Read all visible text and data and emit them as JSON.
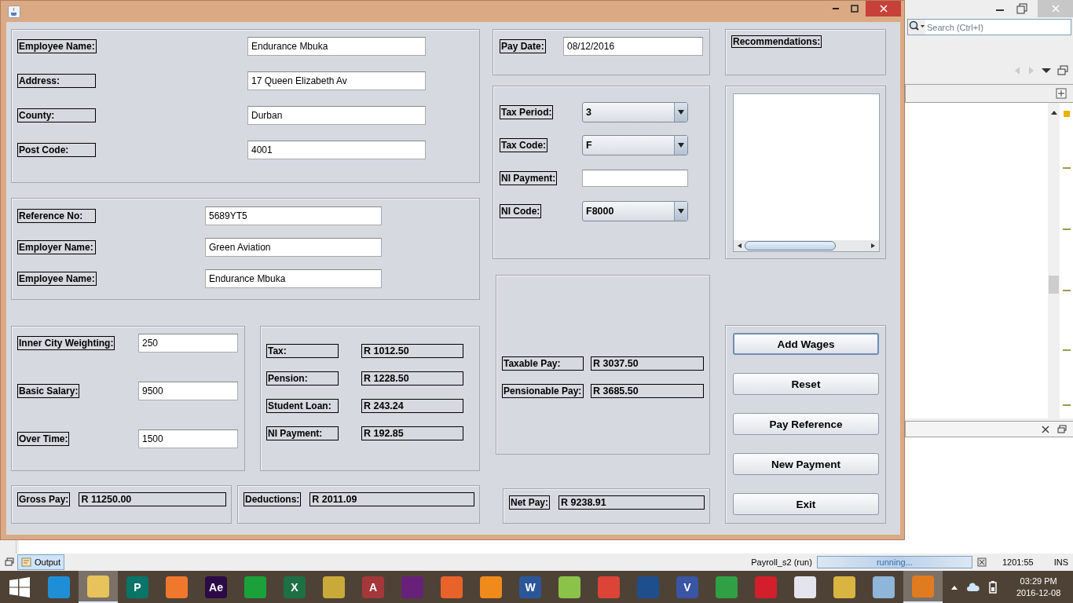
{
  "personal": [
    {
      "label": "Employee Name:",
      "value": "Endurance Mbuka"
    },
    {
      "label": "Address:",
      "value": "17 Queen Elizabeth Av"
    },
    {
      "label": "County:",
      "value": "Durban"
    },
    {
      "label": "Post Code:",
      "value": "4001"
    }
  ],
  "employment": [
    {
      "label": "Reference No:",
      "value": "5689YT5"
    },
    {
      "label": "Employer Name:",
      "value": "Green Aviation"
    },
    {
      "label": "Employee Name:",
      "value": "Endurance Mbuka"
    }
  ],
  "pay_date": {
    "label": "Pay Date:",
    "value": "08/12/2016"
  },
  "recommendations": {
    "label": "Recommendations:"
  },
  "tax_settings": [
    {
      "kind": "combo",
      "label": "Tax Period:",
      "value": "3"
    },
    {
      "kind": "combo",
      "label": "Tax Code:",
      "value": "F"
    },
    {
      "kind": "field",
      "label": "NI Payment:"
    },
    {
      "kind": "combo",
      "label": "NI Code:",
      "value": "F8000"
    }
  ],
  "earnings": [
    {
      "label": "Inner City Weighting:",
      "value": "250"
    },
    {
      "label": "Basic Salary:",
      "value": "9500"
    },
    {
      "label": "Over Time:",
      "value": "1500"
    }
  ],
  "deductions": [
    {
      "label": "Tax:",
      "value": "R 1012.50"
    },
    {
      "label": "Pension:",
      "value": "R 1228.50"
    },
    {
      "label": "Student Loan:",
      "value": "R 243.24"
    },
    {
      "label": "NI Payment:",
      "value": "R 192.85"
    }
  ],
  "taxable": [
    {
      "label": "Taxable Pay:",
      "value": "R 3037.50"
    },
    {
      "label": "Pensionable Pay:",
      "value": "R 3685.50"
    }
  ],
  "totals": {
    "gross": {
      "label": "Gross Pay:",
      "value": "R 11250.00"
    },
    "deductions": {
      "label": "Deductions:",
      "value": "R 2011.09"
    },
    "net": {
      "label": "Net Pay:",
      "value": "R 9238.91"
    }
  },
  "buttons": [
    {
      "label": "Add Wages",
      "focused": true
    },
    {
      "label": "Reset",
      "focused": false
    },
    {
      "label": "Pay Reference",
      "focused": false
    },
    {
      "label": "New Payment",
      "focused": false
    },
    {
      "label": "Exit",
      "focused": false
    }
  ],
  "ide": {
    "search_placeholder": "Search (Ctrl+I)",
    "output_tab": "Output",
    "process": "Payroll_s2 (run)",
    "progress": "running...",
    "busy": true,
    "position": "1201:55",
    "mode": "INS"
  },
  "taskbar": {
    "apps": [
      {
        "color": "#1e8fd6",
        "highlighted": false
      },
      {
        "color": "#e8c25a",
        "highlighted": true
      },
      {
        "color": "#077568",
        "label": "P",
        "highlighted": false
      },
      {
        "color": "#f0782d",
        "highlighted": false
      },
      {
        "color": "#2b0a45",
        "label": "Ae",
        "highlighted": false
      },
      {
        "color": "#1aa13a",
        "highlighted": false
      },
      {
        "color": "#1d7044",
        "label": "X",
        "highlighted": false
      },
      {
        "color": "#c9a93a",
        "highlighted": false
      },
      {
        "color": "#a4373a",
        "label": "A",
        "highlighted": false
      },
      {
        "color": "#68217a",
        "highlighted": false
      },
      {
        "color": "#e8632a",
        "highlighted": false
      },
      {
        "color": "#f08a1c",
        "highlighted": false
      },
      {
        "color": "#2b579a",
        "label": "W",
        "highlighted": false
      },
      {
        "color": "#8bc34a",
        "highlighted": false
      },
      {
        "color": "#db4437",
        "highlighted": false
      },
      {
        "color": "#1f4e8c",
        "highlighted": false
      },
      {
        "color": "#3955a3",
        "label": "V",
        "highlighted": false
      },
      {
        "color": "#2fa043",
        "highlighted": false
      },
      {
        "color": "#d21f2b",
        "highlighted": false
      },
      {
        "color": "#e4e4ee",
        "highlighted": false
      },
      {
        "color": "#d9b441",
        "highlighted": false
      },
      {
        "color": "#8fb5d9",
        "highlighted": false
      },
      {
        "color": "#e07b20",
        "highlighted": true
      }
    ],
    "time": "03:29 PM",
    "date": "2016-12-08"
  }
}
